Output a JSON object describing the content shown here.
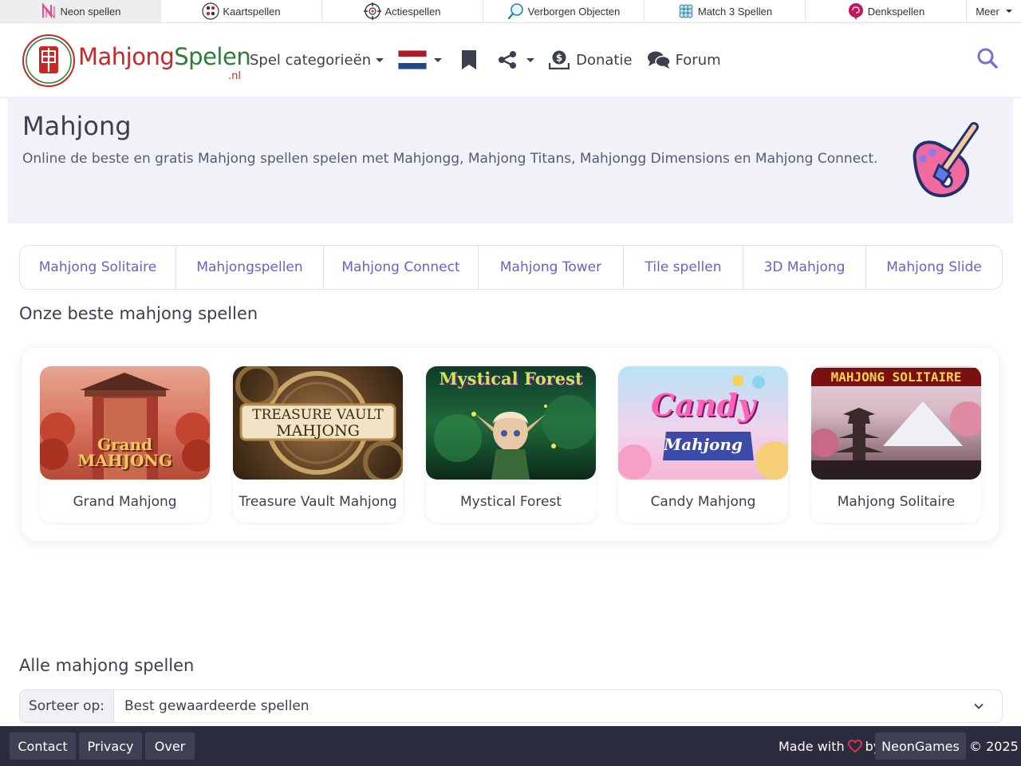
{
  "network": {
    "items": [
      {
        "label": "Neon spellen",
        "icon": "neon-n-icon"
      },
      {
        "label": "Kaartspellen",
        "icon": "cards-icon"
      },
      {
        "label": "Actiespellen",
        "icon": "crosshair-icon"
      },
      {
        "label": "Verborgen Objecten",
        "icon": "magnifier-icon"
      },
      {
        "label": "Match 3 Spellen",
        "icon": "match3-icon"
      },
      {
        "label": "Denkspellen",
        "icon": "brain-icon"
      }
    ],
    "more_label": "Meer"
  },
  "header": {
    "logo_part1": "Mahjong",
    "logo_part2": "Spelen",
    "logo_tld": ".nl",
    "categories_label": "Spel categorieën",
    "donate_label": "Donatie",
    "forum_label": "Forum"
  },
  "hero": {
    "title": "Mahjong",
    "description": "Online de beste en gratis Mahjong spellen spelen met Mahjongg, Mahjong Titans, Mahjongg Dimensions en Mahjong Connect."
  },
  "tabs": [
    "Mahjong Solitaire",
    "Mahjongspellen",
    "Mahjong Connect",
    "Mahjong Tower",
    "Tile spellen",
    "3D Mahjong",
    "Mahjong Slide"
  ],
  "best": {
    "title": "Onze beste mahjong spellen",
    "games": [
      {
        "name": "Grand Mahjong",
        "thumb_line1": "Grand",
        "thumb_line2": "MAHJONG"
      },
      {
        "name": "Treasure Vault Mahjong",
        "thumb_line1": "TREASURE VAULT",
        "thumb_line2": "MAHJONG"
      },
      {
        "name": "Mystical Forest",
        "thumb_line1": "Mystical Forest",
        "thumb_line2": ""
      },
      {
        "name": "Candy Mahjong",
        "thumb_line1": "Candy",
        "thumb_line2": "Mahjong"
      },
      {
        "name": "Mahjong Solitaire",
        "thumb_line1": "MAHJONG SOLITAIRE",
        "thumb_line2": ""
      }
    ]
  },
  "all": {
    "title": "Alle mahjong spellen",
    "sort_label": "Sorteer op:",
    "sort_value": "Best gewaardeerde spellen"
  },
  "footer": {
    "links": [
      "Contact",
      "Privacy",
      "Over"
    ],
    "made_with": "Made with",
    "by": "by",
    "brand": "NeonGames",
    "copyright": "© 2025"
  },
  "colors": {
    "accent": "#6f5fc4",
    "hero_bg": "#f1f2f8",
    "footer_bg": "#2b2d3e",
    "logo_red": "#c62828",
    "logo_green": "#2e7d32"
  }
}
